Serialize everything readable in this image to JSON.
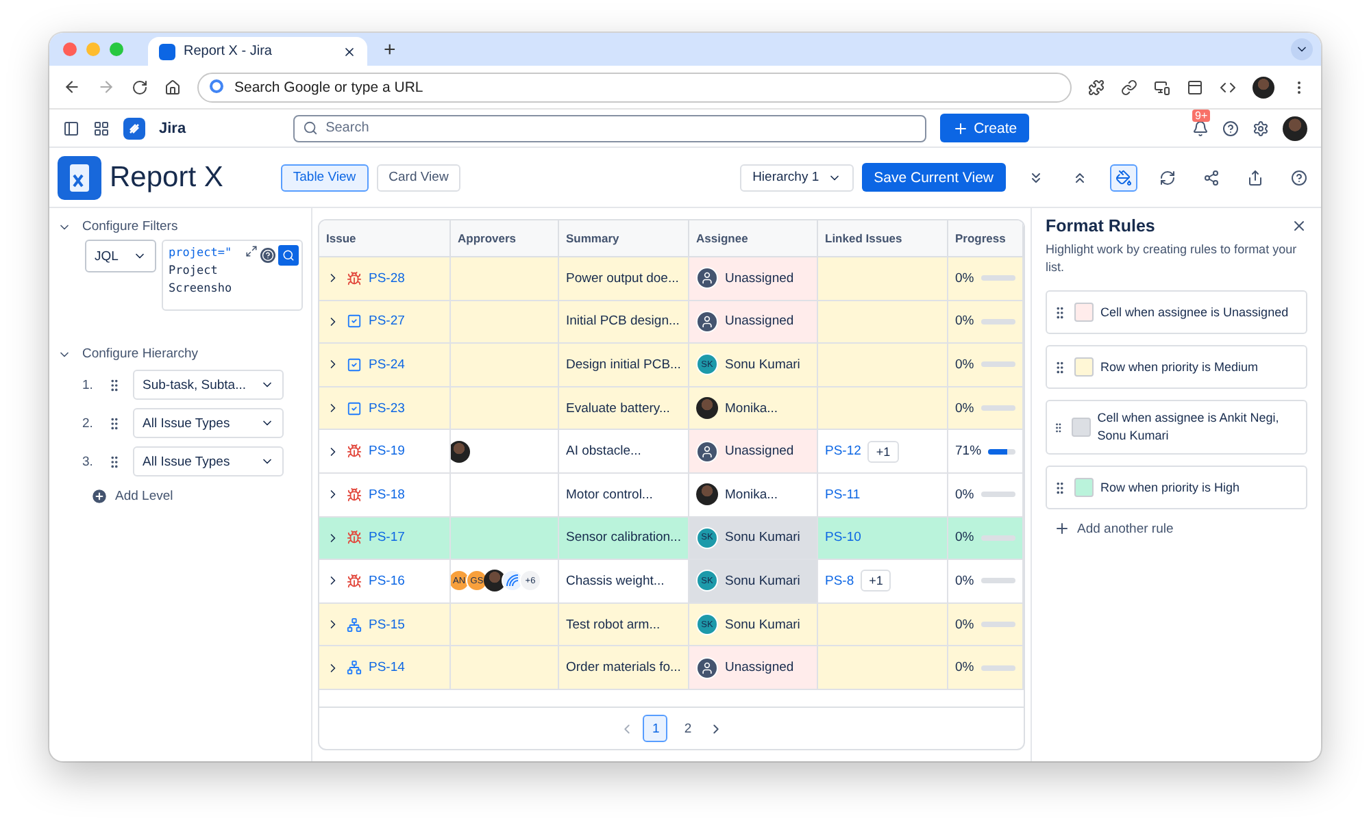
{
  "browser": {
    "tab_title": "Report X - Jira",
    "new_tab": "+",
    "address_placeholder": "Search Google or type a URL"
  },
  "topbar": {
    "product": "Jira",
    "search_placeholder": "Search",
    "create": "Create",
    "notifications": "9+"
  },
  "header": {
    "title": "Report X",
    "views": [
      {
        "label": "Table View",
        "selected": true
      },
      {
        "label": "Card View",
        "selected": false
      }
    ],
    "hierarchy": "Hierarchy 1",
    "save": "Save Current View"
  },
  "filters": {
    "title": "Configure Filters",
    "mode": "JQL",
    "query_lines": [
      "project=\"",
      "Project",
      "Screensho"
    ]
  },
  "hierarchy": {
    "title": "Configure Hierarchy",
    "levels": [
      {
        "number": "1.",
        "value": "Sub-task, Subta..."
      },
      {
        "number": "2.",
        "value": "All Issue Types"
      },
      {
        "number": "3.",
        "value": "All Issue Types"
      }
    ],
    "add": "Add Level"
  },
  "table": {
    "columns": [
      "Issue",
      "Approvers",
      "Summary",
      "Assignee",
      "Linked Issues",
      "Progress"
    ],
    "rows": [
      {
        "kind": "bug",
        "key": "PS-28",
        "color": "#fff7d6",
        "approvers": [],
        "summary": "Power output doe...",
        "assignee": {
          "kind": "unassigned",
          "name": "Unassigned",
          "color": "#ffeceb"
        },
        "progress": "0%",
        "level": 0
      },
      {
        "kind": "task",
        "key": "PS-27",
        "color": "#fff7d6",
        "approvers": [],
        "summary": "Initial PCB design...",
        "assignee": {
          "kind": "unassigned",
          "name": "Unassigned",
          "color": "#ffeceb"
        },
        "progress": "0%",
        "level": 0
      },
      {
        "kind": "task",
        "key": "PS-24",
        "color": "#fff7d6",
        "approvers": [],
        "summary": "Design initial PCB...",
        "assignee": {
          "kind": "initials",
          "initials": "SK",
          "name": "Sonu Kumari"
        },
        "progress": "0%",
        "level": 0
      },
      {
        "kind": "task",
        "key": "PS-23",
        "color": "#fff7d6",
        "approvers": [],
        "summary": "Evaluate battery...",
        "assignee": {
          "kind": "photo",
          "name": "Monika..."
        },
        "progress": "0%",
        "level": 0
      },
      {
        "kind": "bug",
        "key": "PS-19",
        "color": "#ffffff",
        "approvers": [
          {
            "kind": "photo"
          }
        ],
        "summary": "AI obstacle...",
        "assignee": {
          "kind": "unassigned",
          "name": "Unassigned",
          "color": "#ffeceb"
        },
        "linked": {
          "key": "PS-12",
          "more": "+1"
        },
        "progress": "71%",
        "level": 0.71
      },
      {
        "kind": "bug",
        "key": "PS-18",
        "color": "#ffffff",
        "approvers": [],
        "summary": "Motor control...",
        "assignee": {
          "kind": "photo",
          "name": "Monika..."
        },
        "linked": {
          "key": "PS-11"
        },
        "progress": "0%",
        "level": 0
      },
      {
        "kind": "bug",
        "key": "PS-17",
        "color": "#baf3db",
        "approvers": [],
        "summary": "Sensor calibration...",
        "assignee": {
          "kind": "initials",
          "initials": "SK",
          "name": "Sonu Kumari",
          "color": "#dcdfe4"
        },
        "linked": {
          "key": "PS-10"
        },
        "progress": "0%",
        "level": 0
      },
      {
        "kind": "bug",
        "key": "PS-16",
        "color": "#ffffff",
        "approvers": [
          {
            "kind": "initials",
            "text": "AN"
          },
          {
            "kind": "initials",
            "text": "GS"
          },
          {
            "kind": "photo"
          },
          {
            "kind": "pattern"
          },
          {
            "kind": "count",
            "text": "+6"
          }
        ],
        "summary": "Chassis weight...",
        "assignee": {
          "kind": "initials",
          "initials": "SK",
          "name": "Sonu Kumari",
          "color": "#dcdfe4"
        },
        "linked": {
          "key": "PS-8",
          "more": "+1"
        },
        "progress": "0%",
        "level": 0
      },
      {
        "kind": "subtask",
        "key": "PS-15",
        "color": "#fff7d6",
        "approvers": [],
        "summary": "Test robot arm...",
        "assignee": {
          "kind": "initials",
          "initials": "SK",
          "name": "Sonu Kumari"
        },
        "progress": "0%",
        "level": 0
      },
      {
        "kind": "subtask",
        "key": "PS-14",
        "color": "#fff7d6",
        "approvers": [],
        "summary": "Order materials fo...",
        "assignee": {
          "kind": "unassigned",
          "name": "Unassigned",
          "color": "#ffeceb"
        },
        "progress": "0%",
        "level": 0
      }
    ],
    "pages": [
      {
        "label": "1",
        "selected": true
      },
      {
        "label": "2",
        "selected": false
      }
    ]
  },
  "format_rules": {
    "title": "Format Rules",
    "description": "Highlight work by creating rules to format your list.",
    "rules": [
      {
        "text": "Cell when assignee is Unassigned",
        "color": "#ffeceb"
      },
      {
        "text": "Row when priority is Medium",
        "color": "#fff7d6"
      },
      {
        "text": "Cell when assignee is Ankit Negi, Sonu Kumari",
        "color": "#dcdfe4"
      },
      {
        "text": "Row when priority is High",
        "color": "#baf3db"
      }
    ],
    "add": "Add another rule"
  }
}
